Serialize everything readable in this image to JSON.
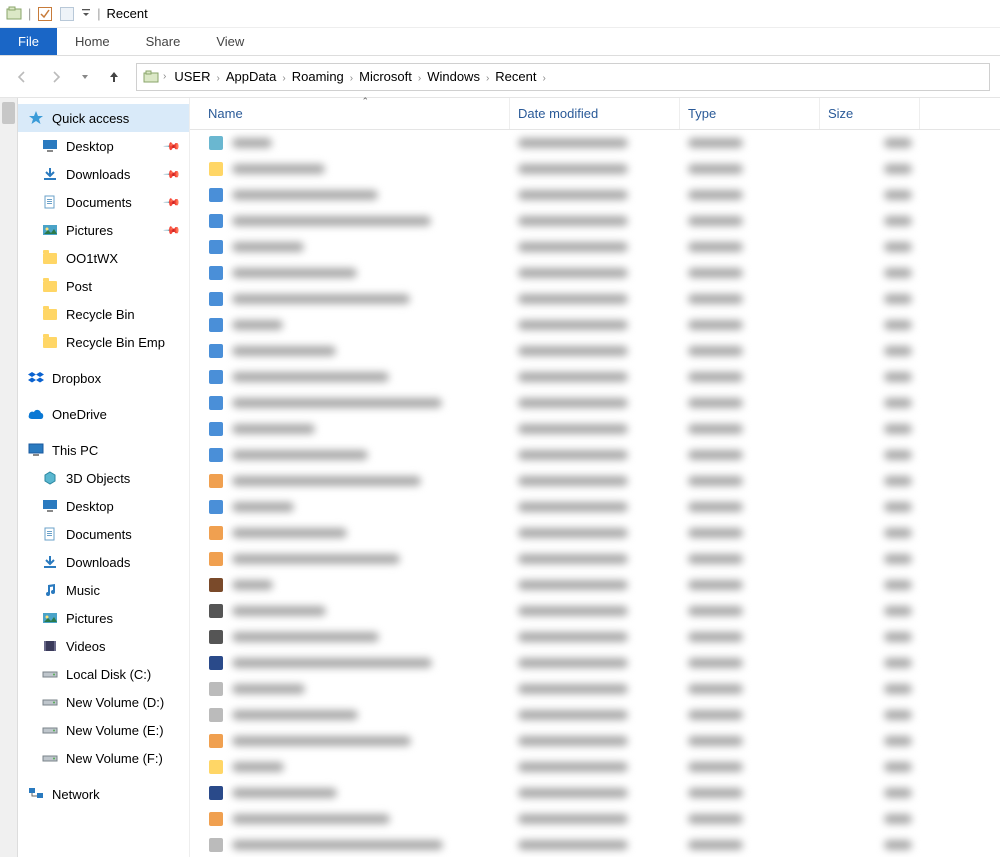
{
  "titlebar": {
    "title": "Recent"
  },
  "ribbon": {
    "file": "File",
    "home": "Home",
    "share": "Share",
    "view": "View"
  },
  "breadcrumb": [
    "USER",
    "AppData",
    "Roaming",
    "Microsoft",
    "Windows",
    "Recent"
  ],
  "sidebar": {
    "quick_access": {
      "label": "Quick access",
      "items": [
        {
          "label": "Desktop",
          "icon": "desktop",
          "pinned": true
        },
        {
          "label": "Downloads",
          "icon": "downloads",
          "pinned": true
        },
        {
          "label": "Documents",
          "icon": "documents",
          "pinned": true
        },
        {
          "label": "Pictures",
          "icon": "pictures",
          "pinned": true
        },
        {
          "label": "OO1tWX",
          "icon": "folder",
          "pinned": false
        },
        {
          "label": "Post",
          "icon": "folder",
          "pinned": false
        },
        {
          "label": "Recycle Bin",
          "icon": "folder",
          "pinned": false
        },
        {
          "label": "Recycle Bin Emp",
          "icon": "folder",
          "pinned": false
        }
      ]
    },
    "dropbox": {
      "label": "Dropbox"
    },
    "onedrive": {
      "label": "OneDrive"
    },
    "this_pc": {
      "label": "This PC",
      "items": [
        {
          "label": "3D Objects",
          "icon": "3d"
        },
        {
          "label": "Desktop",
          "icon": "desktop"
        },
        {
          "label": "Documents",
          "icon": "documents"
        },
        {
          "label": "Downloads",
          "icon": "downloads"
        },
        {
          "label": "Music",
          "icon": "music"
        },
        {
          "label": "Pictures",
          "icon": "pictures"
        },
        {
          "label": "Videos",
          "icon": "videos"
        },
        {
          "label": "Local Disk (C:)",
          "icon": "drive"
        },
        {
          "label": "New Volume (D:)",
          "icon": "drive"
        },
        {
          "label": "New Volume (E:)",
          "icon": "drive"
        },
        {
          "label": "New Volume (F:)",
          "icon": "drive"
        }
      ]
    },
    "network": {
      "label": "Network"
    }
  },
  "columns": {
    "name": "Name",
    "date": "Date modified",
    "type": "Type",
    "size": "Size"
  },
  "files": [
    {
      "icon": "#6ab7d0"
    },
    {
      "icon": "#ffd666"
    },
    {
      "icon": "#4a8fd8"
    },
    {
      "icon": "#4a8fd8"
    },
    {
      "icon": "#4a8fd8"
    },
    {
      "icon": "#4a8fd8"
    },
    {
      "icon": "#4a8fd8"
    },
    {
      "icon": "#4a8fd8"
    },
    {
      "icon": "#4a8fd8"
    },
    {
      "icon": "#4a8fd8"
    },
    {
      "icon": "#4a8fd8"
    },
    {
      "icon": "#4a8fd8"
    },
    {
      "icon": "#4a8fd8"
    },
    {
      "icon": "#f0a050"
    },
    {
      "icon": "#4a8fd8"
    },
    {
      "icon": "#f0a050"
    },
    {
      "icon": "#f0a050"
    },
    {
      "icon": "#7a4a2a"
    },
    {
      "icon": "#555"
    },
    {
      "icon": "#555"
    },
    {
      "icon": "#2a4a8a"
    },
    {
      "icon": "#bbb"
    },
    {
      "icon": "#bbb"
    },
    {
      "icon": "#f0a050"
    },
    {
      "icon": "#ffd666"
    },
    {
      "icon": "#2a4a8a"
    },
    {
      "icon": "#f0a050"
    },
    {
      "icon": "#bbb"
    }
  ]
}
